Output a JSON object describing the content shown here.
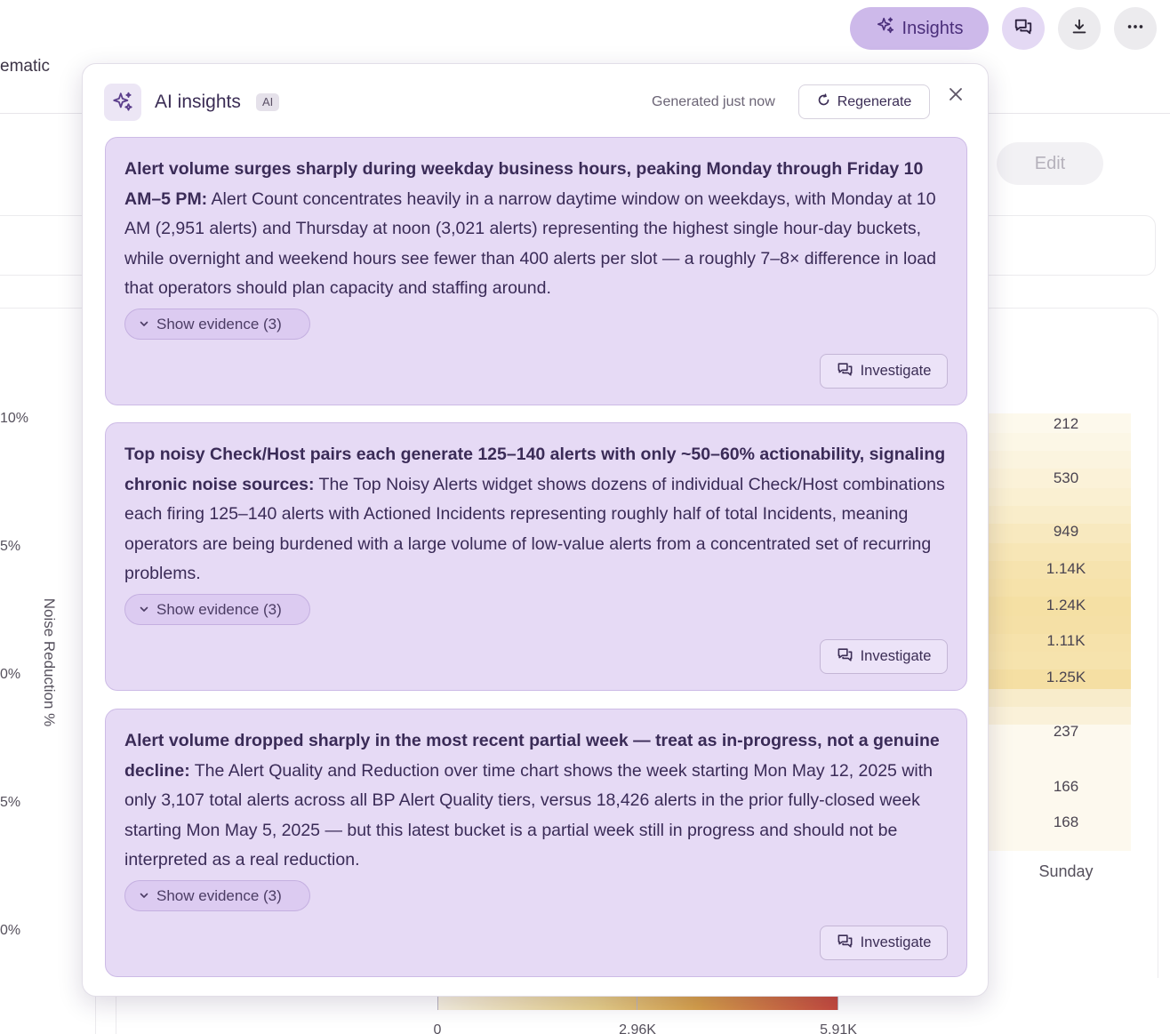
{
  "background": {
    "page_title_partial": "ematic",
    "edit_label": "Edit",
    "y_axis_title": "Noise Reduction %",
    "y_axis_ticks": [
      "10%",
      "5%",
      "0%",
      "5%",
      "0%"
    ],
    "heatmap": {
      "day_label": "Sunday",
      "values": [
        "212",
        "530",
        "949",
        "1.14K",
        "1.24K",
        "1.11K",
        "1.25K",
        "237",
        "166",
        "168"
      ]
    },
    "legend": {
      "min": "0",
      "mid": "2.96K",
      "max": "5.91K"
    }
  },
  "toolbar": {
    "insights_label": "Insights",
    "icons": [
      "sparkles-icon",
      "chat-icon",
      "download-icon",
      "more-icon"
    ]
  },
  "popup": {
    "title": "AI insights",
    "badge": "AI",
    "generated_text": "Generated just now",
    "regenerate_label": "Regenerate",
    "insights": [
      {
        "headline": "Alert volume surges sharply during weekday business hours, peaking Monday through Friday 10 AM–5 PM:",
        "body": " Alert Count concentrates heavily in a narrow daytime window on weekdays, with Monday at 10 AM (2,951 alerts) and Thursday at noon (3,021 alerts) representing the highest single hour-day buckets, while overnight and weekend hours see fewer than 400 alerts per slot — a roughly 7–8× difference in load that operators should plan capacity and staffing around.",
        "evidence_label": "Show evidence (3)",
        "investigate_label": "Investigate"
      },
      {
        "headline": "Top noisy Check/Host pairs each generate 125–140 alerts with only ~50–60% actionability, signaling chronic noise sources:",
        "body": " The Top Noisy Alerts widget shows dozens of individual Check/Host combinations each firing 125–140 alerts with Actioned Incidents representing roughly half of total Incidents, meaning operators are being burdened with a large volume of low-value alerts from a concentrated set of recurring problems.",
        "evidence_label": "Show evidence (3)",
        "investigate_label": "Investigate"
      },
      {
        "headline": "Alert volume dropped sharply in the most recent partial week — treat as in-progress, not a genuine decline:",
        "body": " The Alert Quality and Reduction over time chart shows the week starting Mon May 12, 2025 with only 3,107 total alerts across all BP Alert Quality tiers, versus 18,426 alerts in the prior fully-closed week starting Mon May 5, 2025 — but this latest bucket is a partial week still in progress and should not be interpreted as a real reduction.",
        "evidence_label": "Show evidence (3)",
        "investigate_label": "Investigate"
      }
    ]
  }
}
